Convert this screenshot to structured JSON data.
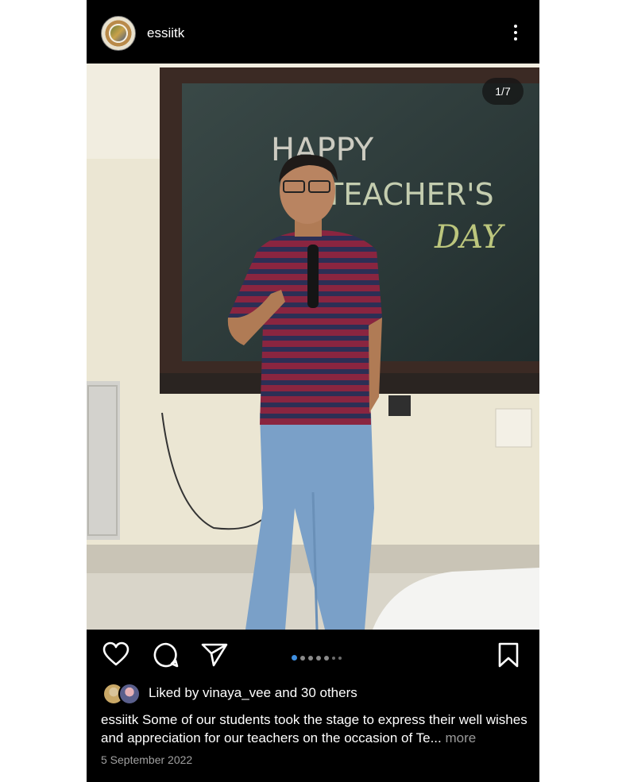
{
  "post": {
    "username": "essiitk",
    "counter": "1/7",
    "photo_chalk_text": [
      "HAPPY",
      "TEACHER'S",
      "DAY"
    ],
    "liked_by_prefix": "Liked by ",
    "liked_by_user": "vinaya_vee",
    "liked_by_suffix": " and 30 others",
    "caption_user": "essiitk",
    "caption_text": "Some of our students took the stage to express their well wishes and appreciation for our teachers on the occasion of Te...",
    "more_label": " more",
    "date": "5 September 2022",
    "carousel": {
      "total": 7,
      "current": 1
    }
  },
  "icons": {
    "like": "heart-icon",
    "comment": "comment-icon",
    "share": "send-icon",
    "save": "bookmark-icon",
    "menu": "more-vertical-icon"
  },
  "colors": {
    "background": "#000000",
    "text": "#ffffff",
    "muted": "#a0a0a0",
    "active_dot": "#3f8fe0"
  }
}
